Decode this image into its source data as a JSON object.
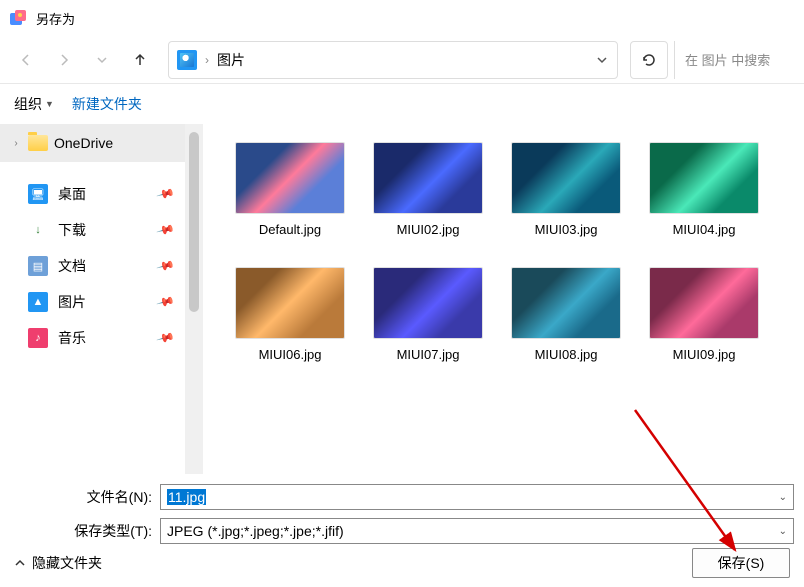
{
  "window": {
    "title": "另存为"
  },
  "nav": {
    "breadcrumb_folder": "图片",
    "search_placeholder": "在 图片 中搜索"
  },
  "toolbar": {
    "organize": "组织",
    "new_folder": "新建文件夹"
  },
  "sidebar": {
    "onedrive": "OneDrive",
    "quick": [
      {
        "label": "桌面",
        "icon_bg": "#2196f3",
        "glyph": "🖥"
      },
      {
        "label": "下载",
        "icon_bg": "#ffffff",
        "glyph": "↓",
        "glyph_color": "#2e7d32"
      },
      {
        "label": "文档",
        "icon_bg": "#6ea0d8",
        "glyph": "▤"
      },
      {
        "label": "图片",
        "icon_bg": "#2196f3",
        "glyph": "▲"
      },
      {
        "label": "音乐",
        "icon_bg": "#ef3e6e",
        "glyph": "♪"
      }
    ]
  },
  "files": [
    {
      "name": "Default.jpg",
      "cls": "t1"
    },
    {
      "name": "MIUI02.jpg",
      "cls": "t2"
    },
    {
      "name": "MIUI03.jpg",
      "cls": "t3"
    },
    {
      "name": "MIUI04.jpg",
      "cls": "t4"
    },
    {
      "name": "MIUI06.jpg",
      "cls": "t5"
    },
    {
      "name": "MIUI07.jpg",
      "cls": "t6"
    },
    {
      "name": "MIUI08.jpg",
      "cls": "t7"
    },
    {
      "name": "MIUI09.jpg",
      "cls": "t8"
    }
  ],
  "form": {
    "filename_label": "文件名(N):",
    "filename_value": "11.jpg",
    "filetype_label": "保存类型(T):",
    "filetype_value": "JPEG (*.jpg;*.jpeg;*.jpe;*.jfif)"
  },
  "footer": {
    "hide_folders": "隐藏文件夹",
    "save": "保存(S)"
  }
}
